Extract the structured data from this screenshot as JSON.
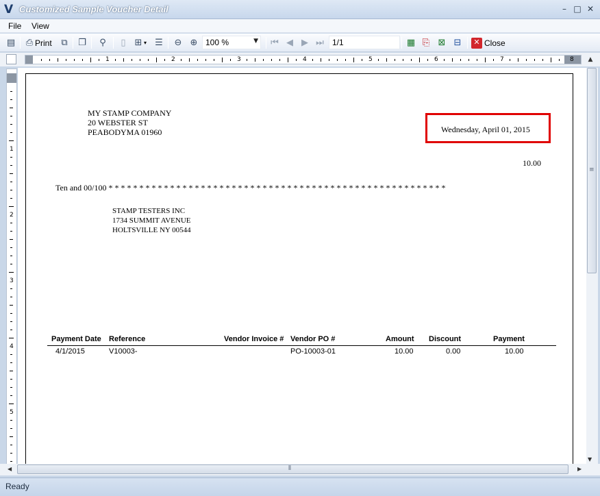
{
  "window": {
    "title": "Customized Sample Voucher Detail",
    "app_icon": "V",
    "minimize": "–",
    "maximize": "□",
    "close": "✕"
  },
  "menu": {
    "file": "File",
    "view": "View"
  },
  "toolbar": {
    "print_label": "Print",
    "zoom_value": "100 %",
    "page_value": "1/1",
    "close_label": "Close"
  },
  "ruler": {
    "labels": [
      "1",
      "2",
      "3",
      "4",
      "5",
      "6",
      "7",
      "8"
    ],
    "v_labels": [
      "1",
      "2",
      "3",
      "4",
      "5"
    ]
  },
  "report": {
    "company": {
      "name": "MY STAMP COMPANY",
      "address1": "20 WEBSTER ST",
      "address2": "PEABODYMA 01960"
    },
    "date": "Wednesday, April 01, 2015",
    "amount": "10.00",
    "amount_words": "Ten and 00/100 * * * * * * * * * * * * * * * * * * * * * * * * * * * * * * * * * * * * * * * * * * * * * * * * * * * * * * *",
    "payee": {
      "name": "STAMP TESTERS INC",
      "address1": "1734 SUMMIT AVENUE",
      "address2": "HOLTSVILLE NY 00544"
    },
    "table": {
      "headers": {
        "payment_date": "Payment Date",
        "reference": "Reference",
        "vendor_invoice": "Vendor Invoice #",
        "vendor_po": "Vendor PO #",
        "amount": "Amount",
        "discount": "Discount",
        "payment": "Payment"
      },
      "rows": [
        {
          "payment_date": "4/1/2015",
          "reference": "V10003-",
          "vendor_invoice": "",
          "vendor_po": "PO-10003-01",
          "amount": "10.00",
          "discount": "0.00",
          "payment": "10.00"
        }
      ]
    }
  },
  "status": {
    "text": "Ready"
  }
}
